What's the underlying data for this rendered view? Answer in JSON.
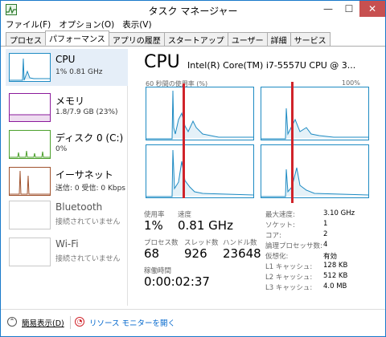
{
  "window": {
    "title": "タスク マネージャー",
    "min": "—",
    "max": "☐",
    "close": "✕"
  },
  "menu": [
    "ファイル(F)",
    "オプション(O)",
    "表示(V)"
  ],
  "tabs": [
    "プロセス",
    "パフォーマンス",
    "アプリの履歴",
    "スタートアップ",
    "ユーザー",
    "詳細",
    "サービス"
  ],
  "active_tab": 1,
  "sidebar": [
    {
      "title": "CPU",
      "sub": "1% 0.81 GHz",
      "color": "#1e8bc3",
      "icon": "cpu-graph-icon"
    },
    {
      "title": "メモリ",
      "sub": "1.8/7.9 GB (23%)",
      "color": "#8b1a9b",
      "icon": "memory-graph-icon"
    },
    {
      "title": "ディスク 0 (C:)",
      "sub": "0%",
      "color": "#4ca02c",
      "icon": "disk-graph-icon"
    },
    {
      "title": "イーサネット",
      "sub": "送信: 0 受信: 0 Kbps",
      "color": "#a0522d",
      "icon": "ethernet-graph-icon"
    },
    {
      "title": "Bluetooth",
      "sub": "接続されていません",
      "color": "#b0b0b0",
      "icon": "bluetooth-graph-icon"
    },
    {
      "title": "Wi-Fi",
      "sub": "接続されていません",
      "color": "#b0b0b0",
      "icon": "wifi-graph-icon"
    }
  ],
  "main": {
    "title": "CPU",
    "model": "Intel(R) Core(TM) i7-5557U CPU @ 3...",
    "graph_label": "60 秒間の使用率 (%)",
    "graph_max": "100%",
    "accent": "#1e8bc3",
    "stats": {
      "usage_label": "使用率",
      "usage_value": "1%",
      "speed_label": "速度",
      "speed_value": "0.81 GHz",
      "proc_label": "プロセス数",
      "proc_value": "68",
      "thread_label": "スレッド数",
      "thread_value": "926",
      "handle_label": "ハンドル数",
      "handle_value": "23648",
      "uptime_label": "稼働時間",
      "uptime_value": "0:00:02:37"
    },
    "props": [
      {
        "k": "最大速度:",
        "v": "3.10 GHz"
      },
      {
        "k": "ソケット:",
        "v": "1"
      },
      {
        "k": "コア:",
        "v": "2"
      },
      {
        "k": "論理プロセッサ数:",
        "v": "4"
      },
      {
        "k": "仮想化:",
        "v": "有効"
      },
      {
        "k": "L1 キャッシュ:",
        "v": "128 KB"
      },
      {
        "k": "L2 キャッシュ:",
        "v": "512 KB"
      },
      {
        "k": "L3 キャッシュ:",
        "v": "4.0 MB"
      }
    ]
  },
  "footer": {
    "collapse": "簡易表示(D)",
    "monitor": "リソース モニターを開く"
  },
  "marker_color": "#d0232a"
}
